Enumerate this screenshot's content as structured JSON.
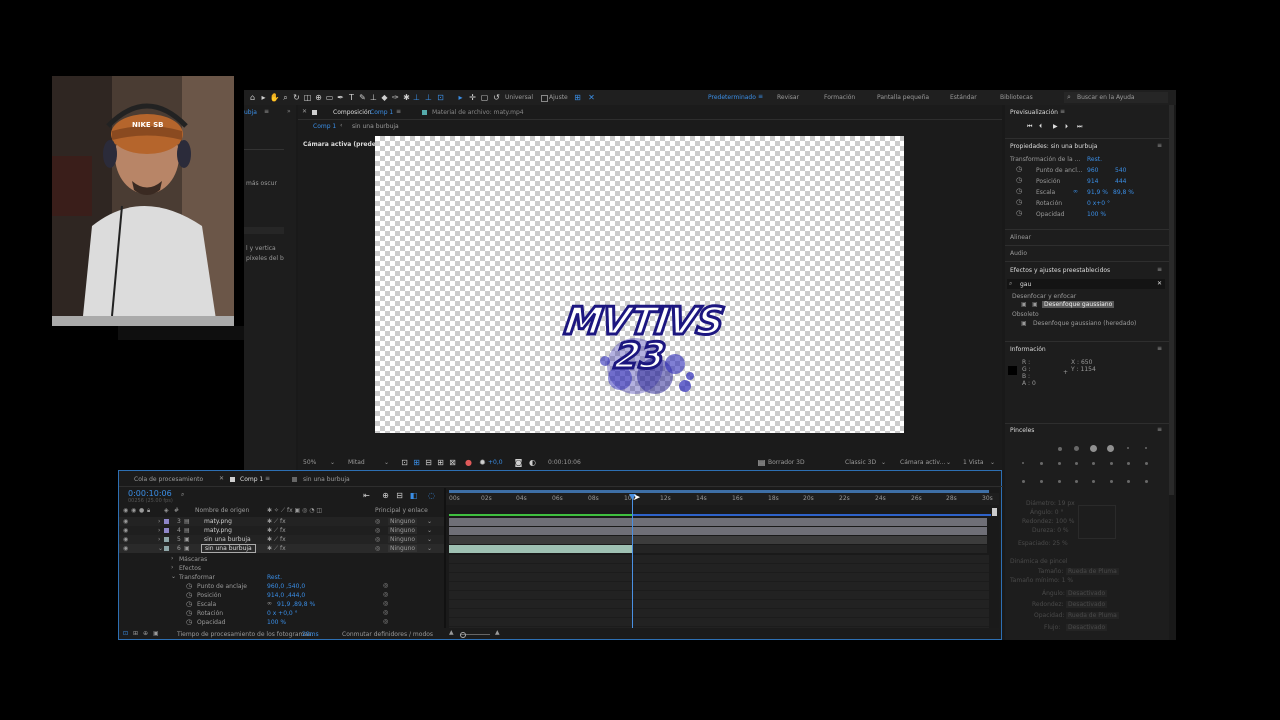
{
  "toolbar": {
    "universal": "Universal",
    "ajuste": "Ajuste",
    "workspaces": [
      "Predeterminado",
      "Revisar",
      "Formación",
      "Pantalla pequeña",
      "Estándar",
      "Bibliotecas"
    ],
    "search_placeholder": "Buscar en la Ayuda"
  },
  "left_panel": {
    "tab": "ubja",
    "items": [
      "más oscur",
      "l y vertica",
      "píxeles del b"
    ]
  },
  "comp_panel": {
    "tab_label": "Composición",
    "tab_comp": "Comp 1",
    "footage_tab": "Material de archivo: maty.mp4",
    "breadcrumb_1": "Comp 1",
    "breadcrumb_2": "sin una burbuja",
    "active_camera": "Cámara activa (predeterminada)",
    "logo_line1": "MVTIVS",
    "logo_line2": "23",
    "zoom": "50%",
    "resolution": "Mitad",
    "plus_value": "+0,0",
    "timecode": "0:00:10:06",
    "borrador": "Borrador 3D",
    "renderer": "Classic 3D",
    "camera": "Cámara activ...",
    "views": "1 Vista"
  },
  "timeline": {
    "tabs": [
      "Cola de procesamiento",
      "Comp 1",
      "sin una burbuja"
    ],
    "timecode": "0:00:10:06",
    "timecode_sub": "00256 (25.00 fps)",
    "col_name": "Nombre de origen",
    "col_parent": "Principal y enlace",
    "ruler": [
      "00s",
      "02s",
      "04s",
      "06s",
      "08s",
      "10s",
      "12s",
      "14s",
      "16s",
      "18s",
      "20s",
      "22s",
      "24s",
      "26s",
      "28s",
      "30s"
    ],
    "layers": [
      {
        "num": "3",
        "name": "maty.png",
        "parent": "Ninguno",
        "color": "#8f86c9"
      },
      {
        "num": "4",
        "name": "maty.png",
        "parent": "Ninguno",
        "color": "#8f86c9"
      },
      {
        "num": "5",
        "name": "sin una burbuja",
        "parent": "Ninguno",
        "color": "#8fa6a8"
      },
      {
        "num": "6",
        "name": "sin una burbuja",
        "parent": "Ninguno",
        "color": "#8fa6a8"
      }
    ],
    "props": {
      "mascaras": "Máscaras",
      "efectos": "Efectos",
      "transformar": "Transformar",
      "restablecer": "Rest.",
      "punto": "Punto de anclaje",
      "punto_val": "960,0 ,540,0",
      "posicion": "Posición",
      "posicion_val": "914,0 ,444,0",
      "escala": "Escala",
      "escala_val": "91,9 ,89,8 %",
      "rotacion": "Rotación",
      "rotacion_val": "0 x +0,0 °",
      "opacidad": "Opacidad",
      "opacidad_val": "100 %"
    },
    "status_render": "Tiempo de procesamiento de los fotogramas:",
    "status_render_val": "29ms",
    "status_switch": "Conmutar definidores / modos"
  },
  "right_panel": {
    "preview_title": "Previsualización",
    "props_title": "Propiedades: sin una burbuja",
    "transform_label": "Transformación de la ...",
    "restablecer": "Rest.",
    "rows": [
      {
        "label": "Punto de ancl...",
        "v1": "960",
        "v2": "540"
      },
      {
        "label": "Posición",
        "v1": "914",
        "v2": "444"
      },
      {
        "label": "Escala",
        "v1": "91,9 %",
        "v2": "89,8 %"
      },
      {
        "label": "Rotación",
        "v1": "0 x+0 °",
        "v2": ""
      },
      {
        "label": "Opacidad",
        "v1": "100 %",
        "v2": ""
      }
    ],
    "alinear": "Alinear",
    "audio": "Audio",
    "effects_title": "Efectos y ajustes preestablecidos",
    "effects_search": "gau",
    "cat1": "Desenfocar y enfocar",
    "item1": "Desenfoque gaussiano",
    "cat2": "Obsoleto",
    "item2": "Desenfoque gaussiano (heredado)",
    "info_title": "Información",
    "info_rgba": [
      "R :",
      "G :",
      "B :",
      "A : 0"
    ],
    "info_x": "X : 650",
    "info_y": "Y : 1154",
    "brushes_title": "Pinceles",
    "brush_sizes": [
      "1",
      "3",
      "5",
      "9",
      "13",
      "19",
      "5",
      "9",
      "13",
      "17",
      "21",
      "27",
      "35",
      "45",
      "65",
      "100"
    ],
    "brush_props": [
      "Diámetro: 19 px",
      "Ángulo: 0 °",
      "Redondez: 100 %",
      "Dureza: 0 %",
      "Espaciado: 25 %"
    ],
    "dynamics": [
      "Dinámica de pincel",
      "Tamaño:",
      "Tamaño mínimo: 1 %",
      "Ángulo:",
      "Redondez:",
      "Opacidad:",
      "Flujo:"
    ],
    "dynamics_vals": [
      "Rueda de Pluma",
      "Desactivado",
      "Desactivado",
      "Rueda de Pluma",
      "Desactivado"
    ]
  },
  "webcam": {
    "cap_text": "NIKE SB"
  }
}
